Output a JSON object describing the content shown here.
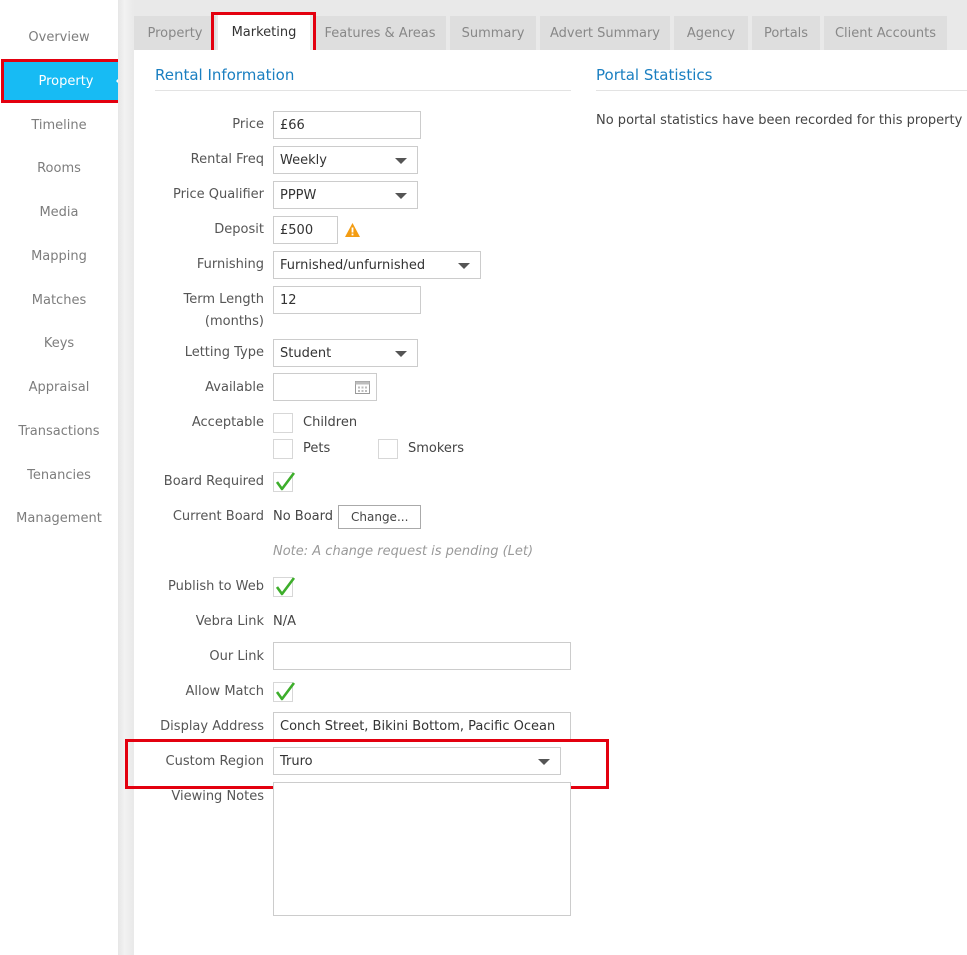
{
  "sidebar": {
    "items": [
      "Overview",
      "Property",
      "Timeline",
      "Rooms",
      "Media",
      "Mapping",
      "Matches",
      "Keys",
      "Appraisal",
      "Transactions",
      "Tenancies",
      "Management"
    ],
    "active": "Property"
  },
  "tabs": [
    "Property",
    "Marketing",
    "Features & Areas",
    "Summary",
    "Advert Summary",
    "Agency",
    "Portals",
    "Client Accounts"
  ],
  "active_tab": "Marketing",
  "rental": {
    "title": "Rental Information",
    "price_label": "Price",
    "price": "£66",
    "rental_freq_label": "Rental Freq",
    "rental_freq": "Weekly",
    "price_qualifier_label": "Price Qualifier",
    "price_qualifier": "PPPW",
    "deposit_label": "Deposit",
    "deposit": "£500",
    "furnishing_label": "Furnishing",
    "furnishing": "Furnished/unfurnished",
    "term_length_label_1": "Term Length",
    "term_length_label_2": "(months)",
    "term_length": "12",
    "letting_type_label": "Letting Type",
    "letting_type": "Student",
    "available_label": "Available",
    "available": "",
    "acceptable_label": "Acceptable",
    "children_label": "Children",
    "pets_label": "Pets",
    "smokers_label": "Smokers",
    "board_required_label": "Board Required",
    "current_board_label": "Current Board",
    "current_board": "No Board",
    "change_button": "Change...",
    "note": "Note: A change request is pending (Let)",
    "publish_label": "Publish to Web",
    "vebra_link_label": "Vebra Link",
    "vebra_link": "N/A",
    "our_link_label": "Our Link",
    "our_link": "",
    "allow_match_label": "Allow Match",
    "display_address_label": "Display Address",
    "display_address": "Conch Street, Bikini Bottom, Pacific Ocean",
    "custom_region_label": "Custom Region",
    "custom_region": "Truro",
    "viewing_notes_label": "Viewing Notes",
    "viewing_notes": ""
  },
  "portal": {
    "title": "Portal Statistics",
    "message": "No portal statistics have been recorded for this property"
  },
  "colors": {
    "accent": "#17bbf4",
    "link": "#1a7fc1",
    "highlight": "#e3000f",
    "warning": "#f39c12",
    "check": "#3dae2b"
  },
  "icons": {
    "warning": "warning-icon",
    "calendar": "calendar-icon",
    "check": "checkmark-icon",
    "dropdown": "chevron-down-icon"
  }
}
